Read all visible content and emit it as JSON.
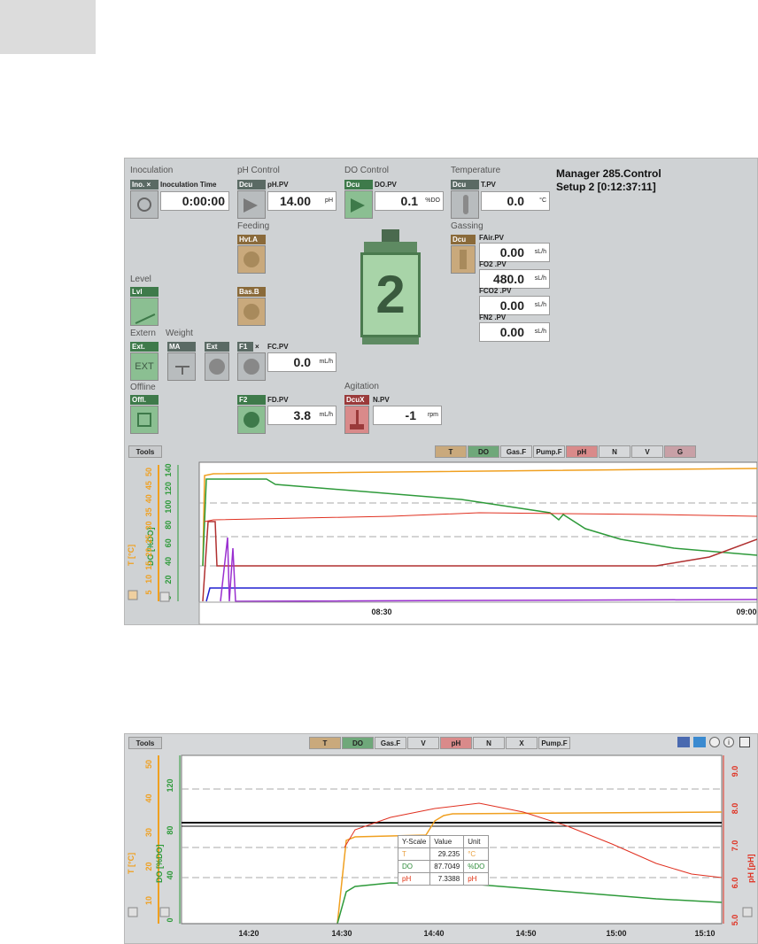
{
  "panel1": {
    "header": {
      "title": "Manager 285.Control",
      "setup": "Setup 2 [0:12:37:11]"
    },
    "inoculation": {
      "section": "Inoculation",
      "tag": "Ino. ×",
      "label": "Inoculation Time",
      "value": "0:00:00"
    },
    "ph": {
      "section": "pH Control",
      "tag": "Dcu",
      "label": "pH.PV",
      "value": "14.00",
      "unit": "pH"
    },
    "do": {
      "section": "DO Control",
      "tag": "Dcu",
      "label": "DO.PV",
      "value": "0.1",
      "unit": "%DO"
    },
    "temperature": {
      "section": "Temperature",
      "tag": "Dcu",
      "label": "T.PV",
      "value": "0.0",
      "unit": "°C"
    },
    "feeding": {
      "section": "Feeding",
      "tag1": "Hvt.A",
      "tag2": "Bas.B"
    },
    "gassing": {
      "section": "Gassing",
      "tag": "Dcu",
      "items": [
        {
          "label": "FAir.PV",
          "value": "0.00",
          "unit": "sL/h"
        },
        {
          "label": "FO2 .PV",
          "value": "480.0",
          "unit": "sL/h"
        },
        {
          "label": "FCO2 .PV",
          "value": "0.00",
          "unit": "sL/h"
        },
        {
          "label": "FN2 .PV",
          "value": "0.00",
          "unit": "sL/h"
        }
      ]
    },
    "level": {
      "section": "Level",
      "tag": "Lvl"
    },
    "extern": {
      "section": "Extern",
      "tag": "Ext.",
      "icon_text": "EXT"
    },
    "weight": {
      "section": "Weight",
      "tag": "MA"
    },
    "ext2": {
      "tag": "Ext"
    },
    "fc": {
      "tag": "F1",
      "x": "×",
      "label": "FC.PV",
      "value": "0.0",
      "unit": "mL/h"
    },
    "offline": {
      "section": "Offline",
      "tag": "Offl."
    },
    "fd": {
      "tag": "F2",
      "label": "FD.PV",
      "value": "3.8",
      "unit": "mL/h"
    },
    "agitation": {
      "section": "Agitation",
      "tag": "DcuX",
      "label": "N.PV",
      "value": "-1",
      "unit": "rpm"
    },
    "vessel_number": "2",
    "tools_label": "Tools",
    "trend_buttons": [
      {
        "label": "T",
        "color": "#c9a97c"
      },
      {
        "label": "DO",
        "color": "#6fa87a"
      },
      {
        "label": "Gas.F",
        "color": "#d6d8da"
      },
      {
        "label": "Pump.F",
        "color": "#d6d8da"
      },
      {
        "label": "pH",
        "color": "#d98a8a"
      },
      {
        "label": "N",
        "color": "#d6d8da"
      },
      {
        "label": "V",
        "color": "#d6d8da"
      },
      {
        "label": "G",
        "color": "#c8a0a6"
      }
    ],
    "axis": {
      "t_label": "T [°C]",
      "do_label": "DO [%DO]",
      "t_ticks": [
        "5",
        "10",
        "15",
        "20",
        "25",
        "30",
        "35",
        "40",
        "45",
        "50"
      ],
      "do_ticks": [
        "0",
        "20",
        "40",
        "60",
        "80",
        "100",
        "120",
        "140"
      ],
      "x_ticks": [
        "08:30",
        "09:00"
      ]
    }
  },
  "panel2": {
    "tools_label": "Tools",
    "trend_buttons": [
      {
        "label": "T",
        "color": "#c9a97c"
      },
      {
        "label": "DO",
        "color": "#6fa87a"
      },
      {
        "label": "Gas.F",
        "color": "#d6d8da"
      },
      {
        "label": "V",
        "color": "#d6d8da"
      },
      {
        "label": "pH",
        "color": "#d98a8a"
      },
      {
        "label": "N",
        "color": "#d6d8da"
      },
      {
        "label": "X",
        "color": "#d6d8da"
      },
      {
        "label": "Pump.F",
        "color": "#d6d8da"
      }
    ],
    "axis": {
      "t_label": "T [°C]",
      "do_label": "DO [%DO]",
      "ph_label": "pH [pH]",
      "t_ticks": [
        "10",
        "20",
        "30",
        "40",
        "50"
      ],
      "do_ticks": [
        "0",
        "40",
        "80",
        "120"
      ],
      "ph_ticks": [
        "5.0",
        "6.0",
        "7.0",
        "8.0",
        "9.0"
      ],
      "x_ticks": [
        "14:20",
        "14:30",
        "14:40",
        "14:50",
        "15:00",
        "15:10"
      ]
    },
    "tooltip": {
      "headers": [
        "Y-Scale",
        "Value",
        "Unit"
      ],
      "rows": [
        {
          "name": "T",
          "value": "29.235",
          "unit": "°C",
          "color": "#e8a040"
        },
        {
          "name": "DO",
          "value": "87.7049",
          "unit": "%DO",
          "color": "#2e8b3a"
        },
        {
          "name": "pH",
          "value": "7.3388",
          "unit": "pH",
          "color": "#e03010"
        }
      ]
    }
  },
  "colors": {
    "temperature": "#f0a020",
    "do": "#2e9a3a",
    "ph": "#e03020",
    "red_trace": "#d02020",
    "blue_trace": "#2020d0",
    "purple_trace": "#9a30d0",
    "brown_trace": "#a03030"
  }
}
